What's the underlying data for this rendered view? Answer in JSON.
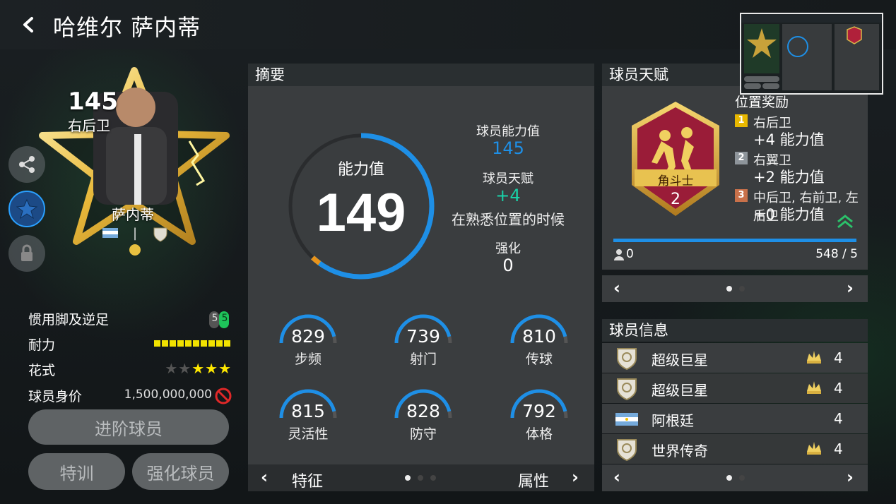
{
  "header": {
    "title": "哈维尔 萨内蒂"
  },
  "card": {
    "rating": "145",
    "position": "右后卫",
    "name": "萨内蒂",
    "separator": "|"
  },
  "attributes": {
    "foot_label": "惯用脚及逆足",
    "foot_left": "5",
    "foot_right": "5",
    "stamina_label": "耐力",
    "stamina_level": 10,
    "skill_label": "花式",
    "skill_stars": 3,
    "skill_max": 5,
    "price_label": "球员身价",
    "price_value": "1,500,000,000"
  },
  "buttons": {
    "advance": "进阶球员",
    "training": "特训",
    "enhance": "强化球员"
  },
  "summary": {
    "header": "摘要",
    "ovr_label": "能力值",
    "ovr_value": "149",
    "ovr_fraction": 0.62,
    "player_ovr_label": "球员能力值",
    "player_ovr_value": "145",
    "talent_label": "球员天赋",
    "talent_value": "+4",
    "talent_note": "在熟悉位置的时候",
    "boost_label": "强化",
    "boost_value": "0",
    "stats": [
      {
        "value": "829",
        "label": "步频"
      },
      {
        "value": "739",
        "label": "射门"
      },
      {
        "value": "810",
        "label": "传球"
      },
      {
        "value": "815",
        "label": "灵活性"
      },
      {
        "value": "828",
        "label": "防守"
      },
      {
        "value": "792",
        "label": "体格"
      }
    ],
    "pager_left": "特征",
    "pager_right": "属性",
    "colors": {
      "accent_blue": "#1e8fe6",
      "ring_orange": "#e8931a",
      "talent_teal": "#19d2a8"
    }
  },
  "talent": {
    "header": "球员天赋",
    "badge_name": "角斗士",
    "badge_level": "2",
    "rewards_title": "位置奖励",
    "rewards": [
      {
        "rank": "1",
        "position": "右后卫",
        "bonus": "+4 能力值",
        "color": "#e8b800"
      },
      {
        "rank": "2",
        "position": "右翼卫",
        "bonus": "+2 能力值",
        "color": "#8e959b"
      },
      {
        "rank": "3",
        "position": "中后卫, 右前卫, 左后卫",
        "bonus": "+0 能力值",
        "color": "#c9714a"
      }
    ],
    "progress_left": "0",
    "progress_right": "548 / 5",
    "progress_fraction": 1.0
  },
  "info": {
    "header": "球员信息",
    "rows": [
      {
        "text": "超级巨星",
        "count": "4",
        "icon": "shield-icon",
        "crown": true
      },
      {
        "text": "超级巨星",
        "count": "4",
        "icon": "shield-icon",
        "crown": true
      },
      {
        "text": "阿根廷",
        "count": "4",
        "icon": "argentina-flag-icon",
        "crown": false
      },
      {
        "text": "世界传奇",
        "count": "4",
        "icon": "shield-icon",
        "crown": true
      }
    ]
  }
}
